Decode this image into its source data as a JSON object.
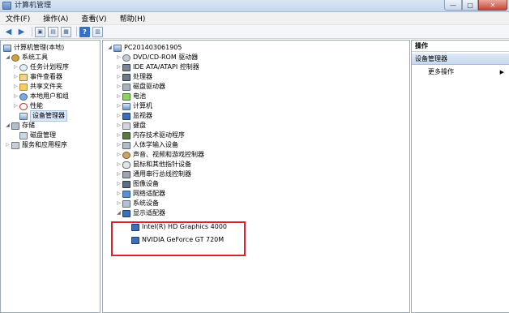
{
  "window": {
    "title": "计算机管理",
    "controls": {
      "minimize": "—",
      "maximize": "□",
      "close": "✕"
    }
  },
  "menubar": [
    "文件(F)",
    "操作(A)",
    "查看(V)",
    "帮助(H)"
  ],
  "toolbar": {
    "icons": [
      "back-icon",
      "forward-icon",
      "up-folder-icon",
      "console-tree-icon",
      "properties-icon",
      "help-icon",
      "show-hide-icon"
    ],
    "help_glyph": "?"
  },
  "left_tree": {
    "root": "计算机管理(本地)",
    "system_tools": "系统工具",
    "system_children": [
      "任务计划程序",
      "事件查看器",
      "共享文件夹",
      "本地用户和组",
      "性能",
      "设备管理器"
    ],
    "storage": "存储",
    "storage_children": [
      "磁盘管理"
    ],
    "services": "服务和应用程序"
  },
  "device_tree": {
    "computer_name": "PC201403061905",
    "categories": [
      "DVD/CD-ROM 驱动器",
      "IDE ATA/ATAPI 控制器",
      "处理器",
      "磁盘驱动器",
      "电池",
      "计算机",
      "监视器",
      "键盘",
      "内存技术驱动程序",
      "人体学输入设备",
      "声音、视频和游戏控制器",
      "鼠标和其他指针设备",
      "通用串行总线控制器",
      "图像设备",
      "网络适配器",
      "系统设备",
      "显示适配器"
    ],
    "display_adapters": [
      "Intel(R) HD Graphics 4000",
      "NVIDIA GeForce GT 720M"
    ]
  },
  "actions_pane": {
    "header": "操作",
    "section": "设备管理器",
    "more_actions": "更多操作",
    "arrow": "▶"
  },
  "colors": {
    "highlight_box": "#d8232a",
    "selection": "#d9e7f7",
    "titlebar": "#c6d7ec"
  }
}
